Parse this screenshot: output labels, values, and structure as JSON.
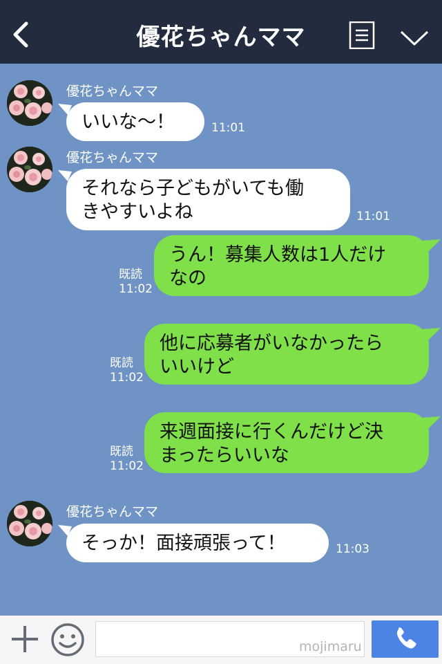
{
  "header": {
    "title": "優花ちゃんママ"
  },
  "messages": [
    {
      "sender": "優花ちゃんママ",
      "text": "いいな〜！",
      "time": "11:01"
    },
    {
      "sender": "優花ちゃんママ",
      "lines": [
        "それなら子どもがいても働",
        "きやすいよね"
      ],
      "time": "11:01"
    },
    {
      "lines": [
        "うん！募集人数は1人だけ",
        "なの"
      ],
      "read": "既読",
      "time": "11:02"
    },
    {
      "lines": [
        "他に応募者がいなかったら",
        "いいけど"
      ],
      "read": "既読",
      "time": "11:02"
    },
    {
      "lines": [
        "来週面接に行くんだけど決",
        "まったらいいな"
      ],
      "read": "既読",
      "time": "11:02"
    },
    {
      "sender": "優花ちゃんママ",
      "text": "そっか！面接頑張って！",
      "time": "11:03"
    }
  ],
  "composer": {
    "watermark": "mojimaru"
  },
  "icons": {
    "back": "chevron-left-icon",
    "menu": "list-icon",
    "collapse": "chevron-down-icon",
    "add": "plus-icon",
    "emoji": "smiley-icon",
    "call": "phone-icon"
  },
  "colors": {
    "header": "#232c3e",
    "chat_background": "#6f93c4",
    "incoming_bubble": "#ffffff",
    "outgoing_bubble": "#80e04a",
    "call_button": "#4c84e6"
  }
}
